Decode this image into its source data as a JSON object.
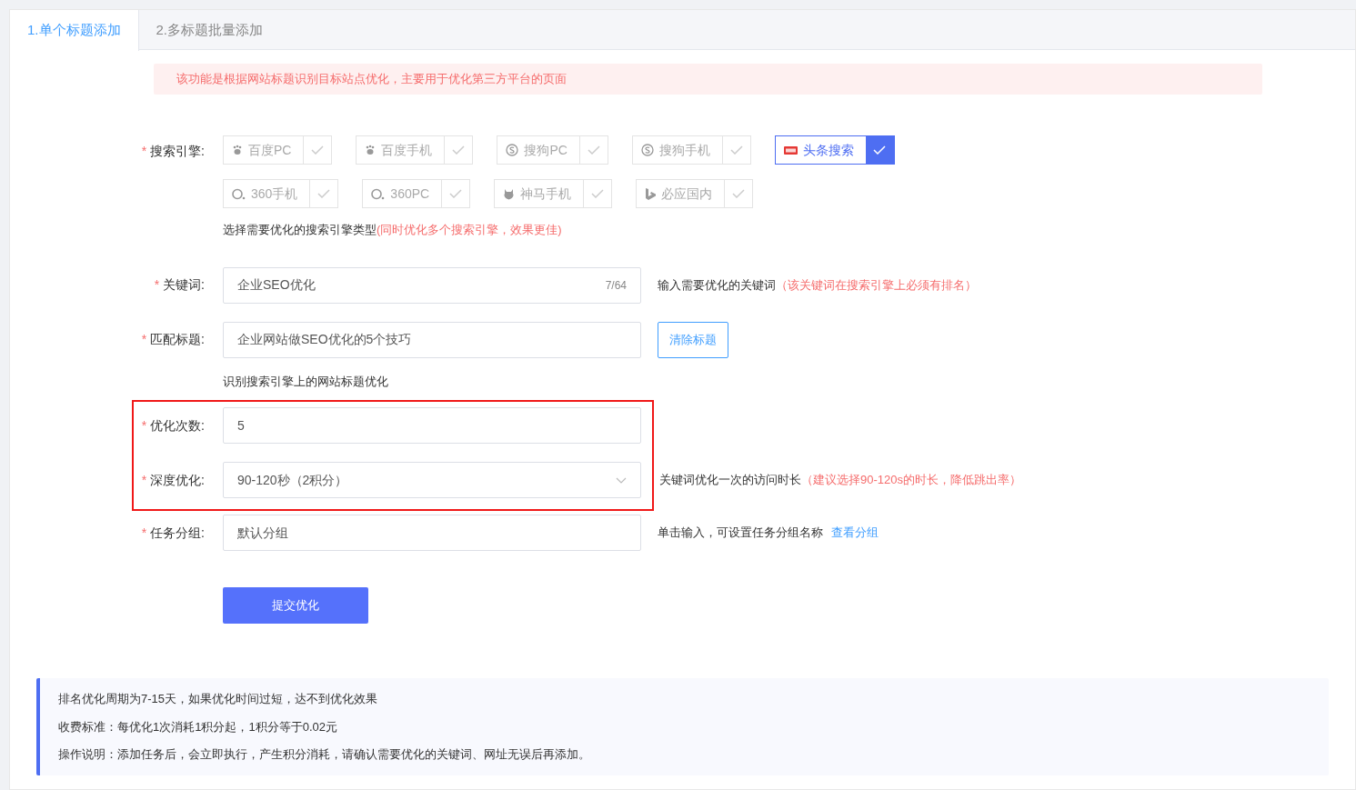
{
  "tabs": [
    {
      "label": "1.单个标题添加",
      "selected": true
    },
    {
      "label": "2.多标题批量添加",
      "selected": false
    }
  ],
  "notice": "该功能是根据网站标题识别目标站点优化，主要用于优化第三方平台的页面",
  "engines": {
    "label": "搜索引擎:",
    "required": "*",
    "rows": [
      [
        {
          "label": "百度PC",
          "kind": "paw",
          "checked": false
        },
        {
          "label": "百度手机",
          "kind": "paw",
          "checked": false
        },
        {
          "label": "搜狗PC",
          "kind": "sogou",
          "checked": false
        },
        {
          "label": "搜狗手机",
          "kind": "sogou",
          "checked": false
        },
        {
          "label": "头条搜索",
          "kind": "toutiao",
          "checked": true
        }
      ],
      [
        {
          "label": "360手机",
          "kind": "ring",
          "checked": false
        },
        {
          "label": "360PC",
          "kind": "ring",
          "checked": false
        },
        {
          "label": "神马手机",
          "kind": "horse",
          "checked": false
        },
        {
          "label": "必应国内",
          "kind": "bing",
          "checked": false
        }
      ]
    ],
    "hint": "选择需要优化的搜索引擎类型",
    "hint_note": "(同时优化多个搜索引擎，效果更佳)"
  },
  "keyword": {
    "label": "关键词:",
    "required": "*",
    "value": "企业SEO优化",
    "counter": "7/64",
    "hint": "输入需要优化的关键词",
    "hint_note": "（该关键词在搜索引擎上必须有排名）"
  },
  "title": {
    "label": "匹配标题:",
    "required": "*",
    "value": "企业网站做SEO优化的5个技巧",
    "button": "清除标题",
    "hint_below": "识别搜索引擎上的网站标题优化"
  },
  "highlighted_fields": [
    {
      "kind": "input",
      "label": "优化次数:",
      "required": "*",
      "value": "5"
    },
    {
      "kind": "select",
      "label": "深度优化:",
      "required": "*",
      "value": "90-120秒（2积分）",
      "hint": "关键词优化一次的访问时长",
      "hint_note": "（建议选择90-120s的时长，降低跳出率）"
    }
  ],
  "group": {
    "label": "任务分组:",
    "required": "*",
    "value": "默认分组",
    "hint": "单击输入，可设置任务分组名称",
    "link": "查看分组"
  },
  "submit": "提交优化",
  "info": [
    "排名优化周期为7-15天，如果优化时间过短，达不到优化效果",
    "收费标准：每优化1次消耗1积分起，1积分等于0.02元",
    "操作说明：添加任务后，会立即执行，产生积分消耗，请确认需要优化的关键词、网址无误后再添加。"
  ]
}
